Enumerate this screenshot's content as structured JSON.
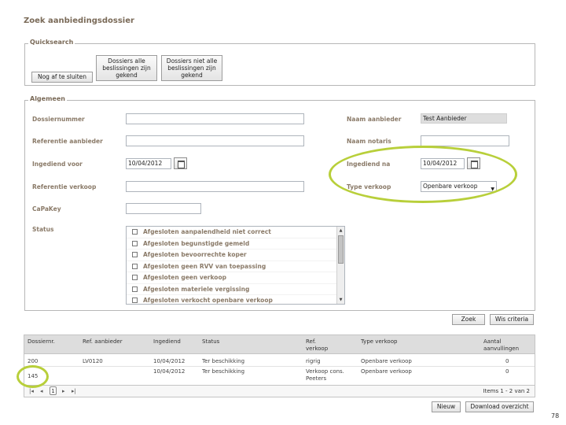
{
  "page_title": "Zoek aanbiedingsdossier",
  "quicksearch": {
    "legend": "Quicksearch",
    "btn_nog_af_te_sluiten": "Nog af te sluiten",
    "btn_dossiers_alle_line1": "Dossiers alle",
    "btn_dossiers_alle_line2": "beslissingen zijn",
    "btn_dossiers_alle_line3": "gekend",
    "btn_niet_alle_line1": "Dossiers niet alle",
    "btn_niet_alle_line2": "beslissingen zijn",
    "btn_niet_alle_line3": "gekend"
  },
  "algemeen": {
    "legend": "Algemeen",
    "dossiernummer_label": "Dossiernummer",
    "dossiernummer_value": "",
    "referentie_aanbieder_label": "Referentie aanbieder",
    "referentie_aanbieder_value": "",
    "ingediend_voor_label": "Ingediend voor",
    "ingediend_voor_value": "10/04/2012",
    "referentie_verkoop_label": "Referentie verkoop",
    "referentie_verkoop_value": "",
    "capakey_label": "CaPaKey",
    "capakey_value": "",
    "status_label": "Status",
    "naam_aanbieder_label": "Naam aanbieder",
    "naam_aanbieder_value": "Test Aanbieder",
    "naam_notaris_label": "Naam notaris",
    "naam_notaris_value": "",
    "ingediend_na_label": "Ingediend na",
    "ingediend_na_value": "10/04/2012",
    "type_verkoop_label": "Type verkoop",
    "type_verkoop_value": "Openbare verkoop",
    "status_options": [
      "Afgesloten aanpalendheid niet correct",
      "Afgesloten begunstigde gemeld",
      "Afgesloten bevoorrechte koper",
      "Afgesloten geen RVV van toepassing",
      "Afgesloten geen verkoop",
      "Afgesloten materiele vergissing",
      "Afgesloten verkocht openbare verkoop"
    ]
  },
  "actions": {
    "zoek": "Zoek",
    "wis_criteria": "Wis criteria"
  },
  "results": {
    "headers": [
      "Dossiernr.",
      "Ref. aanbieder",
      "Ingediend",
      "Status",
      "Ref. verkoop",
      "Type verkoop",
      "Aantal aanvullingen"
    ],
    "header_ref_verkoop_line1": "Ref.",
    "header_ref_verkoop_line2": "verkoop",
    "header_aantal_line1": "Aantal",
    "header_aantal_line2": "aanvullingen",
    "rows": [
      {
        "dossiernr": "200",
        "ref_aanbieder": "LV0120",
        "ingediend": "10/04/2012",
        "status": "Ter beschikking",
        "ref_verkoop": "rigrig",
        "ref_verkoop_2": "",
        "type_verkoop": "Openbare verkoop",
        "aantal": "0"
      },
      {
        "dossiernr": "145",
        "ref_aanbieder": "",
        "ingediend": "10/04/2012",
        "status": "Ter beschikking",
        "ref_verkoop": "Verkoop cons.",
        "ref_verkoop_2": "Peeters",
        "type_verkoop": "Openbare verkoop",
        "aantal": "0"
      }
    ],
    "pager": {
      "current_page": "1",
      "items_text": "Items 1 - 2 van 2"
    }
  },
  "footer": {
    "nieuw": "Nieuw",
    "download_overzicht": "Download overzicht"
  },
  "slide_number": "78",
  "colors": {
    "highlight": "#b8cf3a",
    "label": "#8a7a68",
    "grid_header": "#dddddd"
  }
}
